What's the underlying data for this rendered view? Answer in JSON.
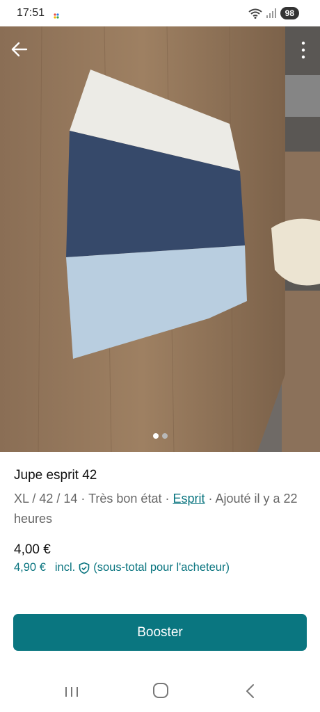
{
  "status": {
    "time": "17:51",
    "battery": "98"
  },
  "listing": {
    "title": "Jupe esprit 42",
    "meta_prefix": "XL / 42 / 14 · Très bon état · ",
    "brand": "Esprit",
    "meta_suffix": " · Ajouté il y a 22 heures",
    "price": "4,00 €",
    "buyer_price": "4,90 €",
    "buyer_incl": "incl.",
    "buyer_note": "(sous-total pour l'acheteur)"
  },
  "actions": {
    "booster_label": "Booster"
  },
  "carousel": {
    "count": 2,
    "active": 1
  },
  "colors": {
    "accent": "#0a7680"
  }
}
